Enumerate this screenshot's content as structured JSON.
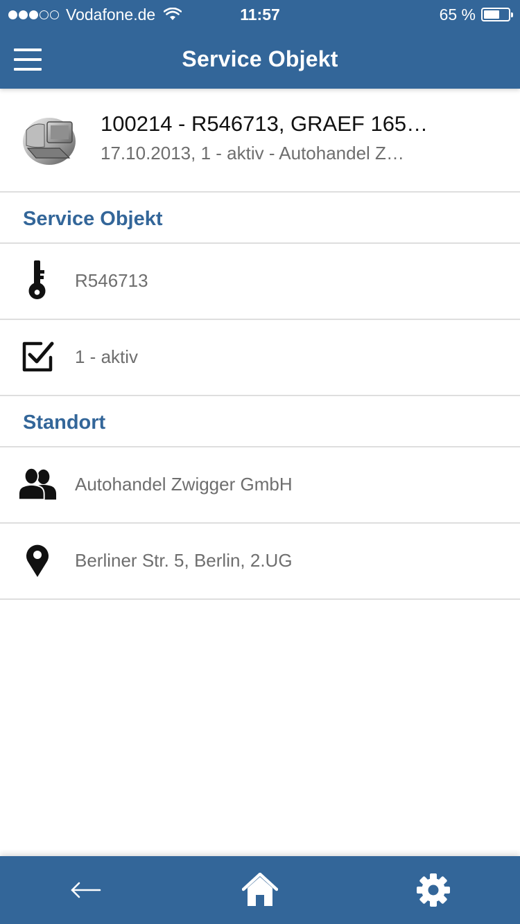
{
  "status_bar": {
    "carrier": "Vodafone.de",
    "time": "11:57",
    "battery_text": "65 %",
    "battery_level_percent": 65,
    "signal_bars_filled": 3,
    "signal_bars_total": 5
  },
  "header": {
    "title": "Service Objekt",
    "menu_icon": "hamburger-menu-icon"
  },
  "object": {
    "icon": "computer-icon",
    "title": "100214 - R546713, GRAEF 165…",
    "subtitle": "17.10.2013, 1 - aktiv - Autohandel Z…"
  },
  "sections": {
    "service_object": {
      "label": "Service Objekt",
      "rows": [
        {
          "icon": "key-icon",
          "text": "R546713"
        },
        {
          "icon": "checkbox-checked-icon",
          "text": "1 - aktiv"
        }
      ]
    },
    "location": {
      "label": "Standort",
      "rows": [
        {
          "icon": "people-icon",
          "text": "Autohandel Zwigger GmbH"
        },
        {
          "icon": "map-pin-icon",
          "text": "Berliner Str. 5, Berlin, 2.UG"
        }
      ]
    }
  },
  "bottom_bar": {
    "back_icon": "back-arrow-icon",
    "home_icon": "home-icon",
    "settings_icon": "gear-icon"
  },
  "colors": {
    "primary": "#336699",
    "section_label": "#336699",
    "secondary_text": "#6e6e6e",
    "divider": "#dedede"
  }
}
